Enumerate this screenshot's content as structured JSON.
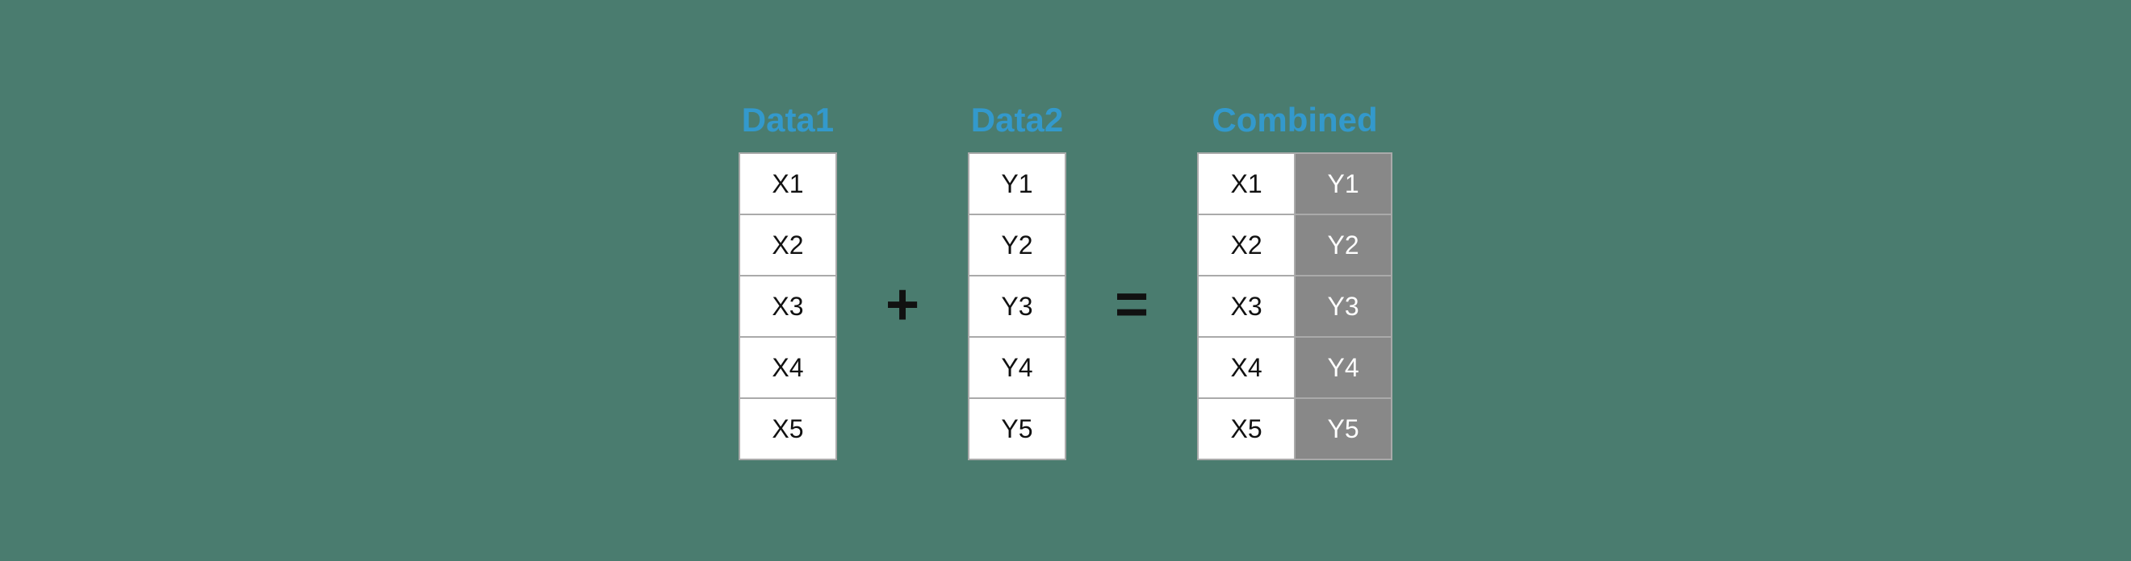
{
  "data1": {
    "title": "Data1",
    "rows": [
      "X1",
      "X2",
      "X3",
      "X4",
      "X5"
    ]
  },
  "data2": {
    "title": "Data2",
    "rows": [
      "Y1",
      "Y2",
      "Y3",
      "Y4",
      "Y5"
    ]
  },
  "combined": {
    "title": "Combined",
    "rows": [
      {
        "col1": "X1",
        "col2": "Y1"
      },
      {
        "col1": "X2",
        "col2": "Y2"
      },
      {
        "col1": "X3",
        "col2": "Y3"
      },
      {
        "col1": "X4",
        "col2": "Y4"
      },
      {
        "col1": "X5",
        "col2": "Y5"
      }
    ]
  },
  "operators": {
    "plus": "+",
    "equals": "="
  }
}
